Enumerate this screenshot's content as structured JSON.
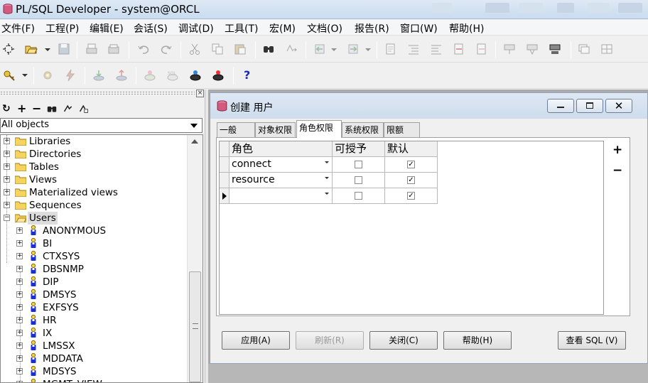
{
  "window": {
    "title": "PL/SQL Developer - system@ORCL"
  },
  "menu": [
    "文件(F)",
    "工程(P)",
    "编辑(E)",
    "会话(S)",
    "调试(D)",
    "工具(T)",
    "宏(M)",
    "文档(O)",
    "报告(R)",
    "窗口(W)",
    "帮助(H)"
  ],
  "browser": {
    "filter": "All objects",
    "folders": [
      "Libraries",
      "Directories",
      "Tables",
      "Views",
      "Materialized views",
      "Sequences",
      "Users"
    ],
    "users": [
      "ANONYMOUS",
      "BI",
      "CTXSYS",
      "DBSNMP",
      "DIP",
      "DMSYS",
      "EXFSYS",
      "HR",
      "IX",
      "LMSSX",
      "MDDATA",
      "MDSYS",
      "MGMT_VIEW"
    ]
  },
  "dialog": {
    "title": "创建 用户",
    "tabs": [
      "一般",
      "对象权限",
      "角色权限",
      "系统权限",
      "限额"
    ],
    "active_tab": "角色权限",
    "grid": {
      "headers": [
        "角色",
        "可授予",
        "默认"
      ],
      "rows": [
        {
          "role": "connect",
          "grantable": false,
          "default": true
        },
        {
          "role": "resource",
          "grantable": false,
          "default": true
        },
        {
          "role": "",
          "grantable": false,
          "default": true
        }
      ]
    },
    "add_label": "+",
    "remove_label": "−",
    "buttons": {
      "apply": "应用(A)",
      "refresh": "刷新(R)",
      "close": "关闭(C)",
      "help": "帮助(H)",
      "view_sql": "查看 SQL (V)"
    }
  },
  "colors": {
    "mdi_background": "#ababab",
    "folder": "#f5d35c",
    "user_icon": "#1a2fd6"
  }
}
